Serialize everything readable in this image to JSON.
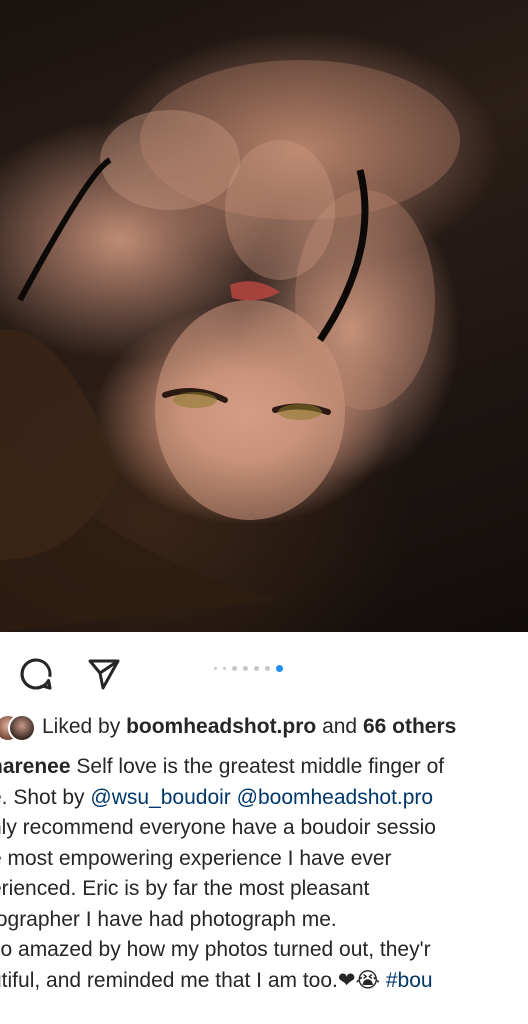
{
  "post": {
    "image": {
      "alt": "boudoir photo"
    }
  },
  "actions": {
    "comment_icon": "comment-icon",
    "share_icon": "share-icon",
    "carousel": {
      "count": 7,
      "active_index": 6
    }
  },
  "likes": {
    "prefix": "Liked by",
    "user": "boomheadshot.pro",
    "joiner": "and",
    "others": "66 others"
  },
  "caption": {
    "username": "harenee",
    "lines": [
      {
        "segments": [
          {
            "text": " Self love is the greatest middle finger of"
          }
        ]
      },
      {
        "segments": [
          {
            "text": "e. Shot by "
          },
          {
            "text": "@wsu_boudoir",
            "type": "mention"
          },
          {
            "text": " "
          },
          {
            "text": "@boomheadshot.pro",
            "type": "mention"
          }
        ]
      },
      {
        "segments": [
          {
            "text": "hly recommend everyone have a boudoir sessio"
          }
        ]
      },
      {
        "segments": [
          {
            "text": "e most empowering experience I have ever"
          }
        ]
      },
      {
        "segments": [
          {
            "text": "erienced. Eric is by far the most pleasant"
          }
        ]
      },
      {
        "segments": [
          {
            "text": "tographer I have had photograph me."
          }
        ]
      },
      {
        "segments": [
          {
            "text": " so amazed by how my photos turned out, they'r"
          }
        ]
      },
      {
        "segments": [
          {
            "text": "utiful, and reminded me that I am too."
          },
          {
            "text": "❤😭",
            "type": "emoji"
          },
          {
            "text": " "
          },
          {
            "text": "#bou",
            "type": "hashtag"
          }
        ]
      }
    ]
  }
}
